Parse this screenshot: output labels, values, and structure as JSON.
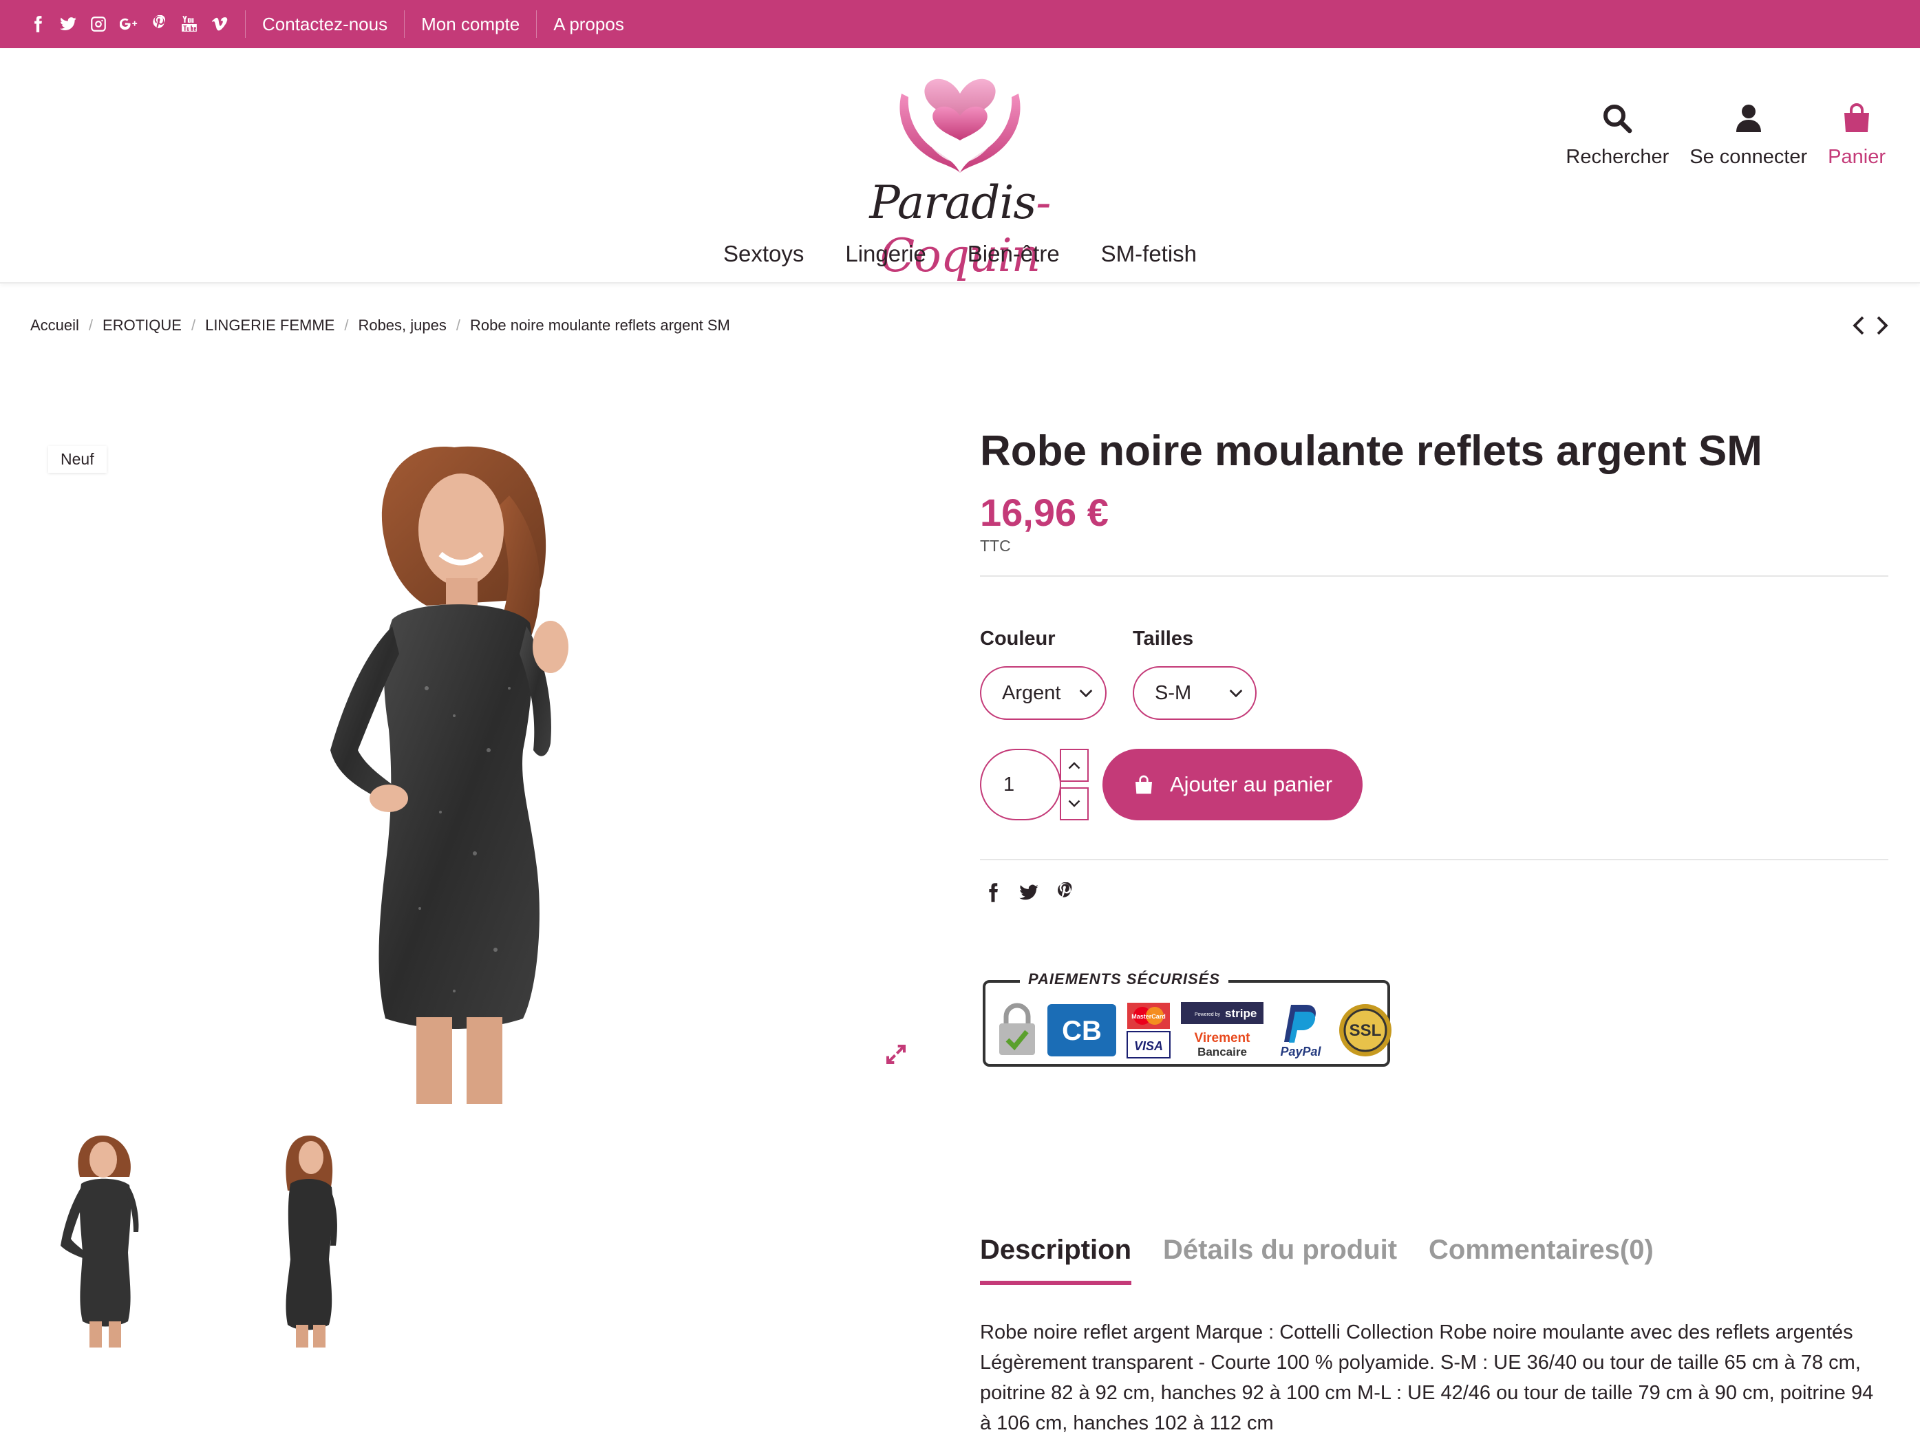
{
  "topbar": {
    "social_icons": [
      "facebook-icon",
      "twitter-icon",
      "instagram-icon",
      "google-plus-icon",
      "pinterest-icon",
      "youtube-icon",
      "vimeo-icon"
    ],
    "links": [
      "Contactez-nous",
      "Mon compte",
      "A propos"
    ]
  },
  "header": {
    "logo": {
      "part1": "Paradis",
      "dash": "-",
      "part2": "Coquin"
    },
    "actions": {
      "search": "Rechercher",
      "login": "Se connecter",
      "cart": "Panier"
    },
    "nav": [
      "Sextoys",
      "Lingerie",
      "Bien-être",
      "SM-fetish"
    ]
  },
  "breadcrumb": [
    "Accueil",
    "EROTIQUE",
    "LINGERIE FEMME",
    "Robes, jupes",
    "Robe noire moulante reflets argent SM"
  ],
  "product": {
    "badge": "Neuf",
    "title": "Robe noire moulante reflets argent SM",
    "price": "16,96 €",
    "tax_label": "TTC",
    "variants": {
      "color_label": "Couleur",
      "color_value": "Argent",
      "size_label": "Tailles",
      "size_value": "S-M"
    },
    "quantity": "1",
    "add_to_cart": "Ajouter au panier",
    "share_icons": [
      "facebook-icon",
      "twitter-icon",
      "pinterest-icon"
    ],
    "payments": {
      "title": "PAIEMENTS SÉCURISÉS",
      "cb": "CB",
      "mastercard": "MasterCard",
      "visa": "VISA",
      "stripe_small": "Powered by",
      "stripe": "stripe",
      "virement1": "Virement",
      "virement2": "Bancaire",
      "paypal": "PayPal",
      "ssl": "SSL"
    }
  },
  "tabs": [
    "Description",
    "Détails du produit",
    "Commentaires(0)"
  ],
  "description": "Robe noire reflet argent Marque : Cottelli Collection Robe noire moulante avec des reflets argentés Légèrement transparent - Courte 100 % polyamide. S-M : UE 36/40 ou tour de taille 65 cm à 78 cm, poitrine 82 à 92 cm, hanches 92 à 100 cm M-L : UE 42/46 ou tour de taille 79 cm à 90 cm, poitrine 94 à 106 cm, hanches 102 à 112 cm",
  "colors": {
    "accent": "#c43a78",
    "text": "#2a2226"
  }
}
